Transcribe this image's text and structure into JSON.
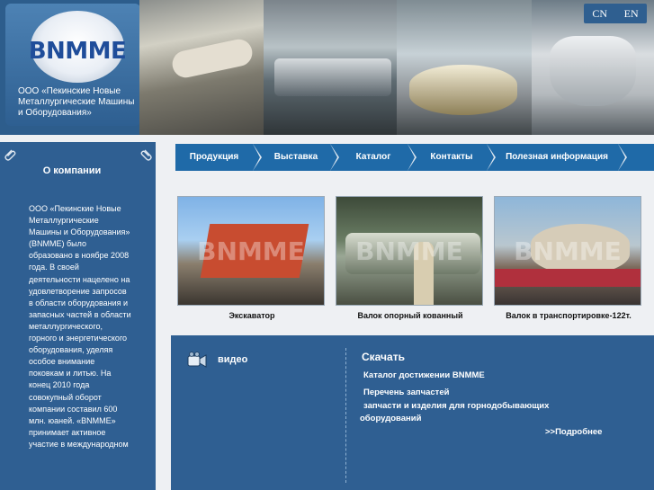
{
  "header": {
    "logo_text": "BNMME",
    "company_caption": "ООО «Пекинские Новые Металлургические Машины и Оборудования»",
    "languages": [
      "CN",
      "EN"
    ]
  },
  "sidebar": {
    "title": "О компании",
    "about_text": "ООО «Пекинские Новые Металлургические Машины и Оборудования» (BNMME) было образовано в ноябре 2008 года. В своей деятельности нацелено на удовлетворение запросов в области оборудования и запасных частей в области металлургического, горного и энергетического оборудования, уделяя особое внимание поковкам и литью. На конец 2010 года совокупный оборот компании составил 600 млн. юаней. «BNMME» принимает активное участие в международном"
  },
  "nav": {
    "items": [
      "Продукция",
      "Выставка",
      "Каталог",
      "Контакты",
      "Полезная информация"
    ]
  },
  "products": [
    {
      "caption": "Экскаватор"
    },
    {
      "caption": "Валок опорный кованный"
    },
    {
      "caption": "Валок в транспортировке-122т."
    }
  ],
  "watermark": "BNMME",
  "bottom": {
    "video_label": "видео",
    "download_title": "Скачать",
    "links": [
      "Каталог достижении BNMME",
      "Перечень запчастей",
      "запчасти и изделия для горнодобывающих оборудований"
    ],
    "more_label": ">>Подробнее"
  },
  "colors": {
    "panel_blue": "#2f5f92",
    "nav_blue": "#1f6aa8",
    "page_bg": "#eef0f3"
  }
}
